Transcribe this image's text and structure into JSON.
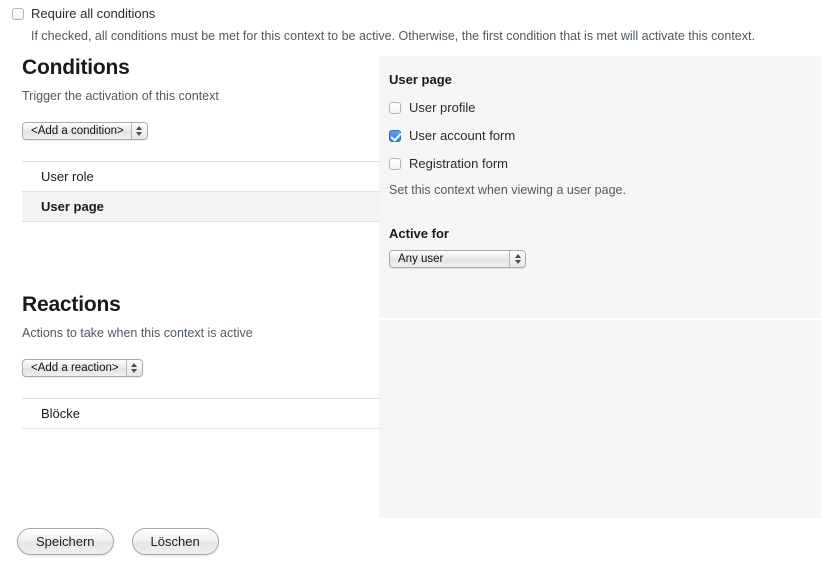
{
  "require_all": {
    "label": "Require all conditions",
    "checked": false,
    "description": "If checked, all conditions must be met for this context to be active. Otherwise, the first condition that is met will activate this context."
  },
  "conditions": {
    "heading": "Conditions",
    "subheading": "Trigger the activation of this context",
    "add_select": "<Add a condition>",
    "items": [
      {
        "label": "User role",
        "selected": false
      },
      {
        "label": "User page",
        "selected": true
      }
    ]
  },
  "reactions": {
    "heading": "Reactions",
    "subheading": "Actions to take when this context is active",
    "add_select": "<Add a reaction>",
    "items": [
      {
        "label": "Blöcke",
        "selected": false
      }
    ]
  },
  "detail_panel": {
    "title": "User page",
    "options": [
      {
        "label": "User profile",
        "checked": false
      },
      {
        "label": "User account form",
        "checked": true
      },
      {
        "label": "Registration form",
        "checked": false
      }
    ],
    "description": "Set this context when viewing a user page.",
    "active_for_label": "Active for",
    "active_for_value": "Any user"
  },
  "footer": {
    "save_label": "Speichern",
    "delete_label": "Löschen"
  },
  "colors": {
    "panel_bg": "#f6f6f6",
    "checkbox_accent": "#2f7fdb",
    "text": "#333333",
    "muted_text": "#4f5a66"
  }
}
